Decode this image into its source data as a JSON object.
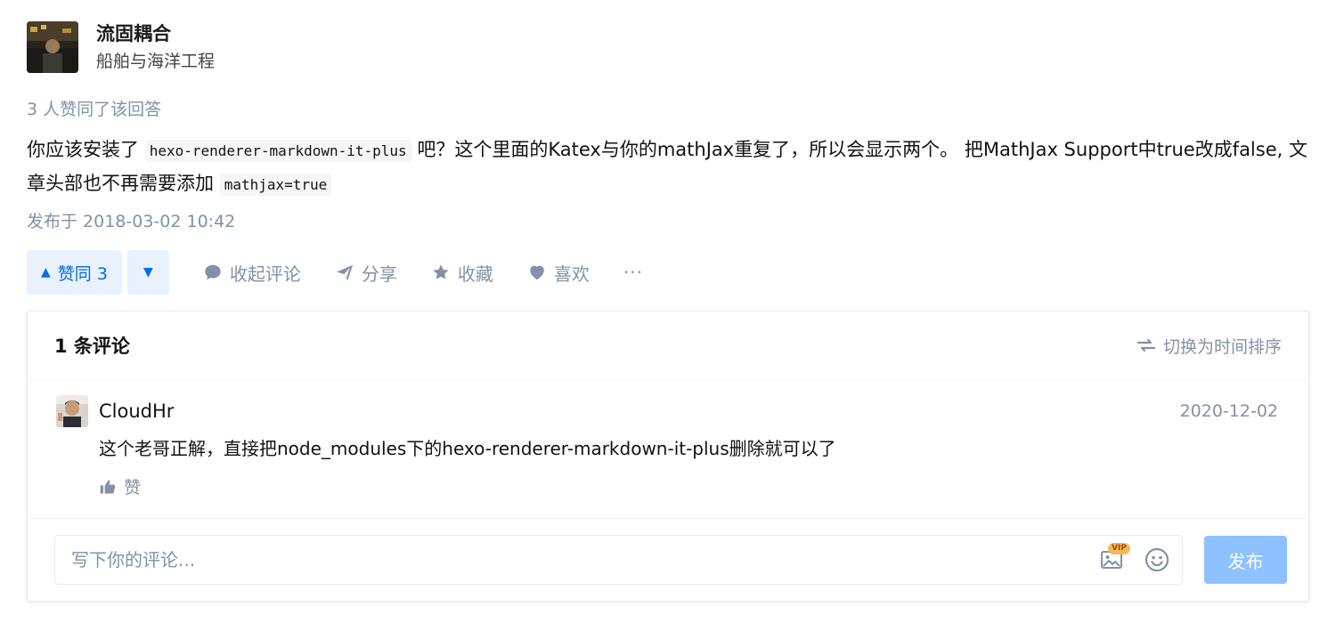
{
  "author": {
    "name": "流固耦合",
    "headline": "船舶与海洋工程"
  },
  "voters_text": "3 人赞同了该回答",
  "answer": {
    "segments": [
      {
        "type": "text",
        "value": "你应该安装了 "
      },
      {
        "type": "code",
        "value": "hexo-renderer-markdown-it-plus"
      },
      {
        "type": "text",
        "value": " 吧？这个里面的Katex与你的mathJax重复了，所以会显示两个。 把MathJax Support中true改成false, 文章头部也不再需要添加 "
      },
      {
        "type": "code",
        "value": "mathjax=true"
      }
    ]
  },
  "published": "发布于 2018-03-02 10:42",
  "actions": {
    "vote_up_label": "赞同 3",
    "collapse_comments": "收起评论",
    "share": "分享",
    "favorite": "收藏",
    "like": "喜欢",
    "more": "···"
  },
  "comments": {
    "count_label": "1 条评论",
    "sort_label": "切换为时间排序",
    "items": [
      {
        "user": "CloudHr",
        "date": "2020-12-02",
        "text": "这个老哥正解，直接把node_modules下的hexo-renderer-markdown-it-plus删除就可以了",
        "like_label": "赞"
      }
    ],
    "editor_placeholder": "写下你的评论...",
    "vip_badge": "VIP",
    "submit_label": "发布"
  },
  "colors": {
    "primary": "#056de8",
    "muted": "#8590a6",
    "vote_bg": "#e8f1fd",
    "submit_disabled": "#8ec1ff"
  }
}
